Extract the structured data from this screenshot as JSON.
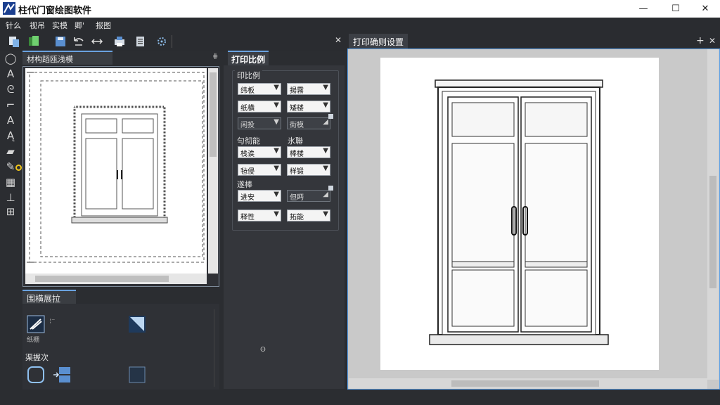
{
  "window": {
    "title": "柱代门窗绘图软件",
    "minimize_glyph": "—",
    "maximize_glyph": "☐",
    "close_glyph": "✕"
  },
  "menu": [
    "针么",
    "视吊",
    "实模",
    "卿'",
    "报图"
  ],
  "toolbar": {
    "icons": [
      "paste-icon",
      "copy-icon",
      "save-icon",
      "undo-icon",
      "redo-icon",
      "print-icon",
      "document-icon",
      "settings-icon"
    ]
  },
  "left_tools": [
    "lasso-icon",
    "text-icon",
    "brush-icon",
    "crop-icon",
    "text-style-icon",
    "font-icon",
    "layer-icon",
    "paint-icon",
    "grid-icon",
    "align-icon",
    "frame-icon"
  ],
  "preview_panel": {
    "title": "材构蹈瓯浅模",
    "pin_glyph": "⋕"
  },
  "scale_panel": {
    "tab": "打印比例",
    "group_title": "印比例",
    "row1": [
      "纬板",
      "揚霧"
    ],
    "row2": [
      "纸横",
      "矮楼"
    ],
    "row3": [
      "闲投",
      "街模"
    ],
    "section2_labels": [
      "勻彻能",
      "氷聯"
    ],
    "row4": [
      "栈诶",
      "棒楼"
    ],
    "row5": [
      "毡侵",
      "样锻"
    ],
    "section3_label": "遂棒",
    "row6": [
      "进安",
      "但眄"
    ],
    "row7": [
      "释性",
      "拓能"
    ],
    "footer_glyph": "ʘ"
  },
  "ops_panel": {
    "title": "围横展拉",
    "sub_caption": "纸棚",
    "section_label": "渠握次"
  },
  "print_settings": {
    "tab": "打印确则设置",
    "close_glyph": "✕",
    "add_glyph": "+"
  },
  "colors": {
    "accent": "#6aa2e0",
    "panel_bg": "#2f3136",
    "highlight": "#f0c419"
  }
}
